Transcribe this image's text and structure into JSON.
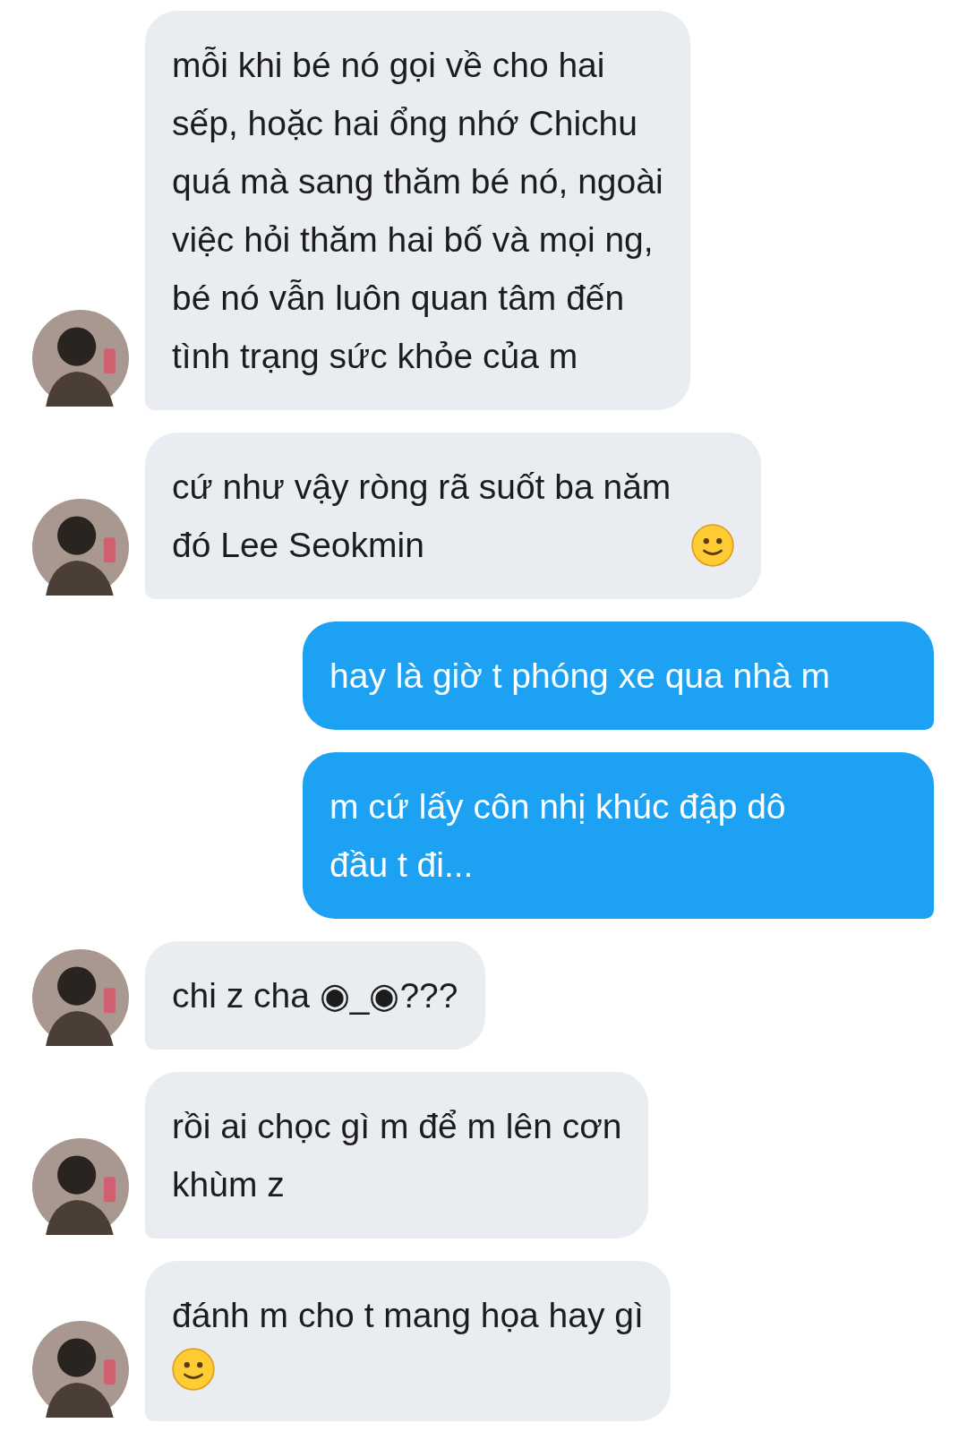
{
  "messages": [
    {
      "kind": "incoming",
      "text": "mỗi khi bé nó gọi về cho hai\nsếp, hoặc hai ổng nhớ Chichu\nquá mà sang thăm bé nó, ngoài\nviệc hỏi thăm hai bố và mọi ng,\nbé nó vẫn luôn quan tâm đến\ntình trạng sức khỏe của m"
    },
    {
      "kind": "incoming",
      "text": "cứ như vậy ròng rã suốt ba năm\nđó Lee Seokmin",
      "smiley": true,
      "smiley_own_line": false
    },
    {
      "kind": "outgoing",
      "text": "hay là giờ t phóng xe qua nhà m"
    },
    {
      "kind": "outgoing",
      "text": "m cứ lấy côn nhị khúc đập dô\nđầu t đi..."
    },
    {
      "kind": "incoming",
      "text": "chi z cha ◉_◉???"
    },
    {
      "kind": "incoming",
      "text": "rồi ai chọc gì m để m lên cơn\nkhùm z"
    },
    {
      "kind": "incoming",
      "text": "đánh m cho t mang họa hay gì",
      "smiley": true,
      "smiley_own_line": true
    }
  ]
}
